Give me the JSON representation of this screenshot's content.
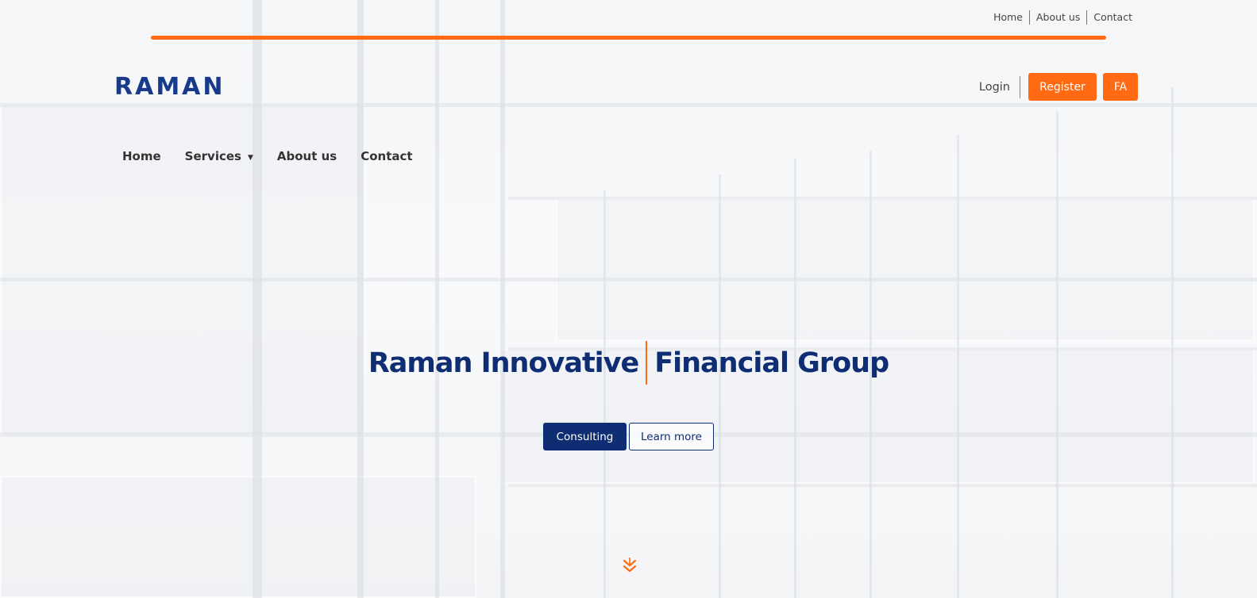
{
  "utility_nav": {
    "home": "Home",
    "about": "About us",
    "contact": "Contact"
  },
  "brand": {
    "logo_text": "RAMAN"
  },
  "auth": {
    "login": "Login",
    "register": "Register",
    "language": "FA"
  },
  "main_nav": {
    "home": "Home",
    "services": "Services",
    "about": "About us",
    "contact": "Contact"
  },
  "hero": {
    "title_left": "Raman Innovative",
    "title_right": "Financial Group",
    "primary_button": "Consulting",
    "secondary_button": "Learn more"
  },
  "icons": {
    "scroll": "double-chevron-down-icon",
    "services_caret": "caret-down-icon"
  },
  "colors": {
    "accent": "#ff6a13",
    "brand_navy": "#0e2d72",
    "logo": "#173a8a"
  }
}
